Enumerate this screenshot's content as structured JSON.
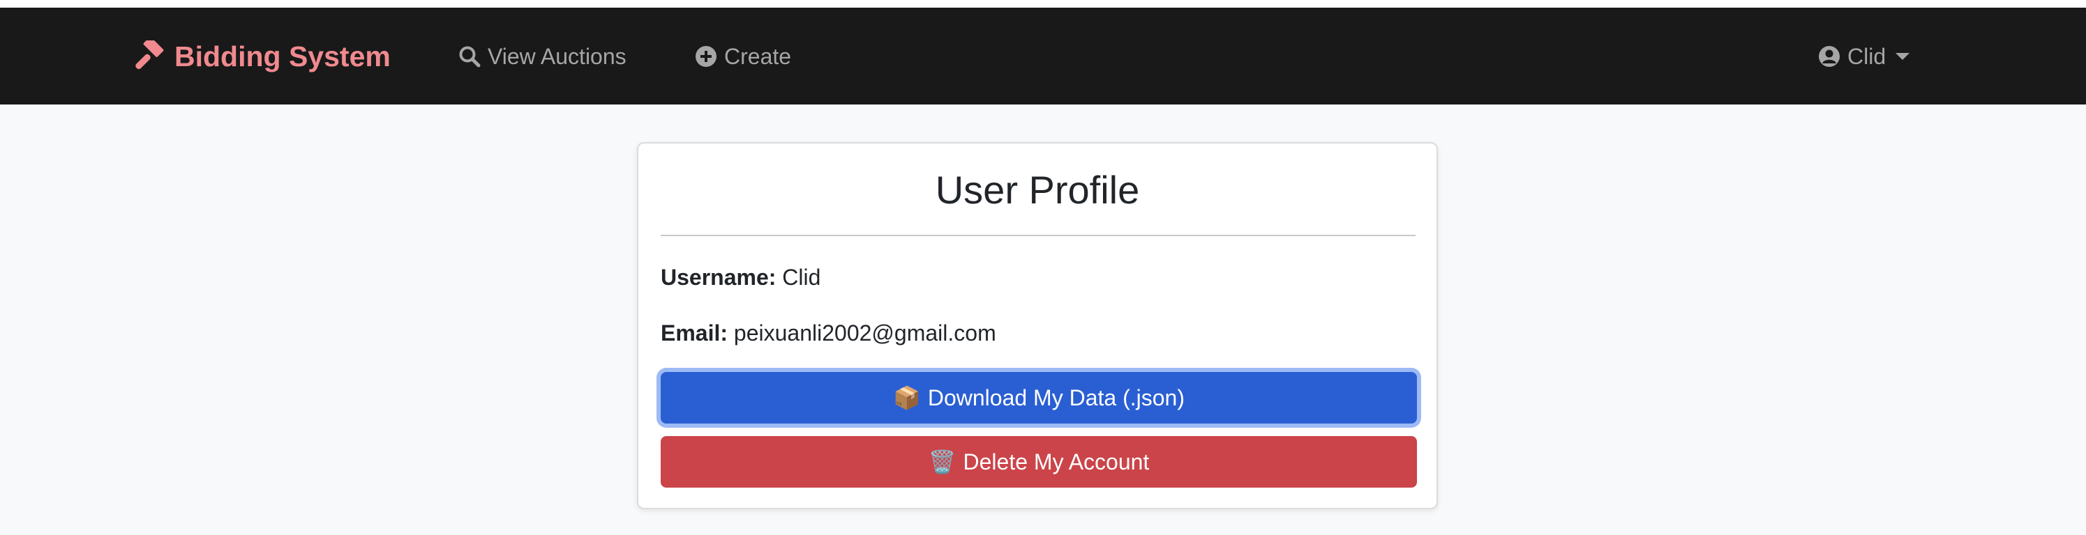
{
  "navbar": {
    "brand": "Bidding System",
    "brand_icon": "gavel-icon",
    "links": [
      {
        "label": "View Auctions",
        "icon": "search-icon"
      },
      {
        "label": "Create",
        "icon": "plus-circle-icon"
      }
    ],
    "user": {
      "label": "Clid",
      "icon": "user-circle-icon"
    },
    "colors": {
      "background": "#191919",
      "brand": "#f08a8f",
      "link": "#a6a6a6"
    }
  },
  "profile": {
    "title": "User Profile",
    "username_label": "Username:",
    "username": "Clid",
    "email_label": "Email:",
    "email": "peixuanli2002@gmail.com",
    "download_emoji": "📦",
    "download_label": "Download My Data (.json)",
    "delete_emoji": "🗑️",
    "delete_label": "Delete My Account",
    "colors": {
      "download": "#2a5fd3",
      "delete": "#cb444a"
    }
  }
}
